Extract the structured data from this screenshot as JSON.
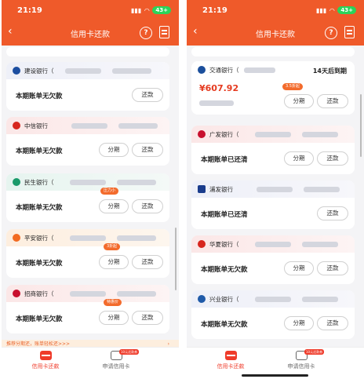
{
  "left": {
    "status_time": "21:19",
    "battery": "43+",
    "title": "信用卡还款",
    "cards": [
      {
        "bank": "建设银行（",
        "status": "本期账单无欠款",
        "repay": "还款"
      },
      {
        "bank": "中信银行",
        "status": "本期账单无欠款",
        "installment": "分期",
        "repay": "还款"
      },
      {
        "bank": "民生银行（",
        "status": "本期账单无欠款",
        "installment": "分期",
        "repay": "还款",
        "tag": "压力小"
      },
      {
        "bank": "平安银行（",
        "status": "本期账单无欠款",
        "installment": "分期",
        "repay": "还款",
        "tag": "3折起"
      },
      {
        "bank": "招商银行（",
        "status": "本期账单无欠款",
        "installment": "分期",
        "repay": "还款",
        "tag": "特惠价"
      }
    ],
    "promo": "推荐分期还，账单轻松还>>>",
    "promo_arrow": "›",
    "tabs": {
      "active": "信用卡还款",
      "other": "申请信用卡",
      "new_tag": "10元还款券"
    }
  },
  "right": {
    "status_time": "21:19",
    "title": "信用卡还款",
    "cards": [
      {
        "bank": "交通银行（",
        "due": "14天后到期",
        "amount": "¥607.92",
        "installment": "分期",
        "repay": "还款",
        "tag": "3.5折起"
      },
      {
        "bank": "广发银行（",
        "status": "本期账单已还清",
        "installment": "分期",
        "repay": "还款"
      },
      {
        "bank": "浦发银行",
        "status": "本期账单已还清",
        "repay": "还款"
      },
      {
        "bank": "华夏银行（",
        "status": "本期账单无欠款",
        "installment": "分期",
        "repay": "还款"
      },
      {
        "bank": "兴业银行（",
        "status": "本期账单无欠款",
        "installment": "分期",
        "repay": "还款"
      }
    ],
    "tabs": {
      "active": "信用卡还款",
      "other": "申请信用卡",
      "new_tag": "10元还款券"
    }
  },
  "icons": {
    "back": "‹",
    "help": "?"
  }
}
